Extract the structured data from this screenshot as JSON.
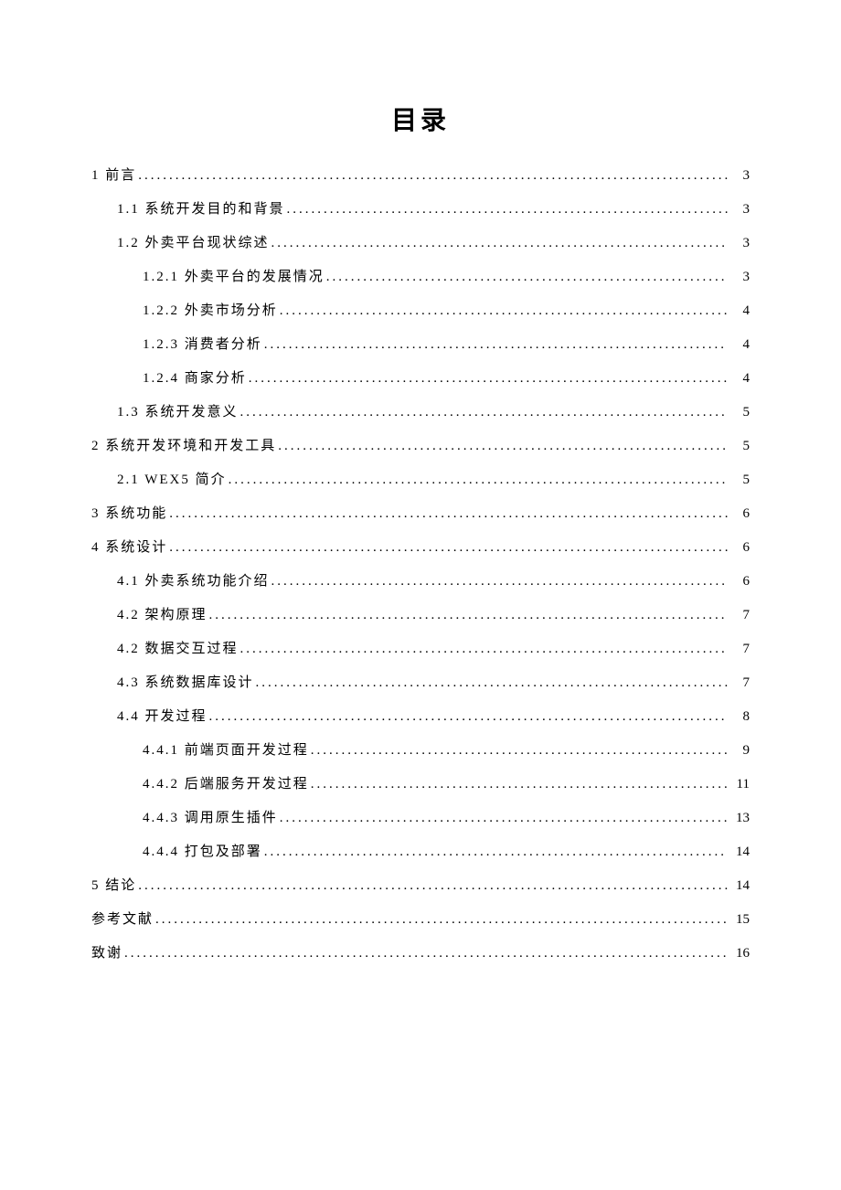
{
  "title": "目录",
  "entries": [
    {
      "level": 1,
      "label": "1 前言",
      "page": "3"
    },
    {
      "level": 2,
      "label": "1.1 系统开发目的和背景",
      "page": "3"
    },
    {
      "level": 2,
      "label": "1.2 外卖平台现状综述",
      "page": "3"
    },
    {
      "level": 3,
      "label": "1.2.1 外卖平台的发展情况",
      "page": "3"
    },
    {
      "level": 3,
      "label": "1.2.2 外卖市场分析",
      "page": "4"
    },
    {
      "level": 3,
      "label": "1.2.3 消费者分析",
      "page": "4"
    },
    {
      "level": 3,
      "label": "1.2.4 商家分析",
      "page": "4"
    },
    {
      "level": 2,
      "label": "1.3 系统开发意义",
      "page": "5"
    },
    {
      "level": 1,
      "label": "2 系统开发环境和开发工具",
      "page": "5"
    },
    {
      "level": 2,
      "label": "2.1 WEX5 简介",
      "page": "5"
    },
    {
      "level": 1,
      "label": "3 系统功能",
      "page": "6"
    },
    {
      "level": 1,
      "label": "4 系统设计",
      "page": "6"
    },
    {
      "level": 2,
      "label": "4.1 外卖系统功能介绍",
      "page": "6"
    },
    {
      "level": 2,
      "label": "4.2  架构原理",
      "page": "7"
    },
    {
      "level": 2,
      "label": "4.2 数据交互过程",
      "page": "7"
    },
    {
      "level": 2,
      "label": "4.3 系统数据库设计",
      "page": "7"
    },
    {
      "level": 2,
      "label": "4.4 开发过程",
      "page": "8"
    },
    {
      "level": 3,
      "label": "4.4.1 前端页面开发过程",
      "page": "9"
    },
    {
      "level": 3,
      "label": "4.4.2 后端服务开发过程",
      "page": "11"
    },
    {
      "level": 3,
      "label": "4.4.3 调用原生插件",
      "page": "13"
    },
    {
      "level": 3,
      "label": "4.4.4 打包及部署",
      "page": "14"
    },
    {
      "level": 1,
      "label": "5 结论",
      "page": "14"
    },
    {
      "level": 1,
      "label": "参考文献",
      "page": "15"
    },
    {
      "level": 1,
      "label": "致谢",
      "page": "16"
    }
  ]
}
